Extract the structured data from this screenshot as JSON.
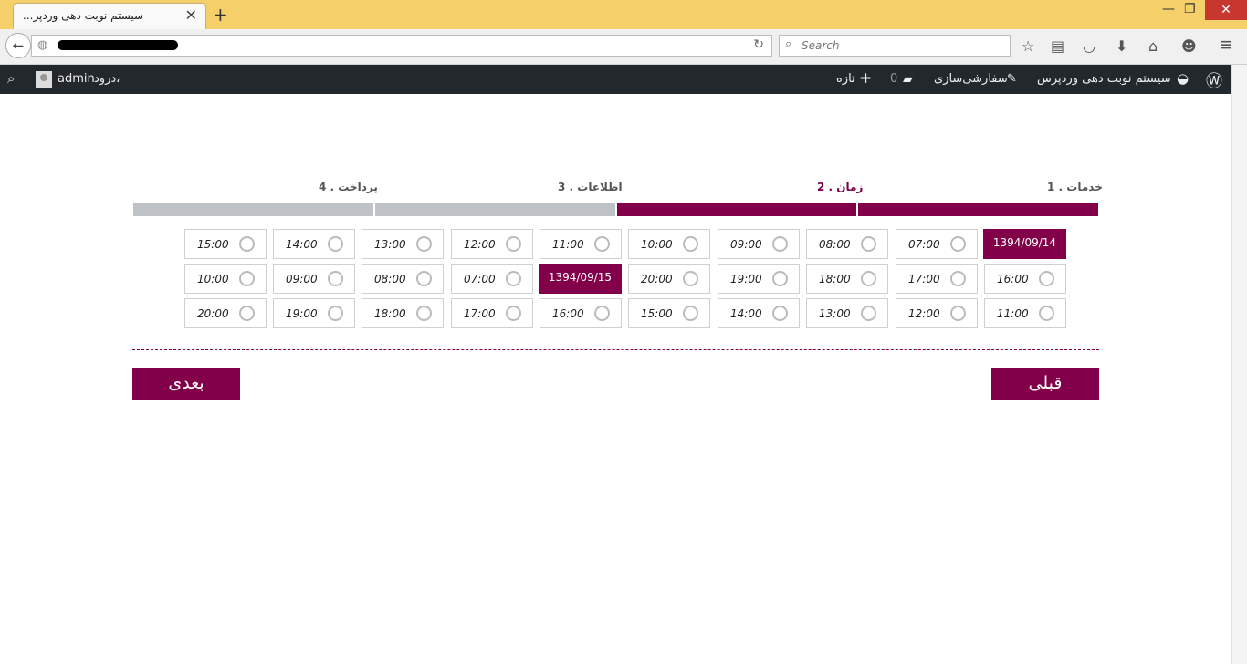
{
  "browser": {
    "tab_title": "سیستم نوبت دهی وردپر...",
    "search_placeholder": "Search",
    "new_tab": "+",
    "close_tab": "✕"
  },
  "adminbar": {
    "site_name": "سیستم نوبت دهی وردپرس",
    "customize": "سفارشی‌سازی",
    "comments_count": "0",
    "new_label": "تازه",
    "greeting": "درود،",
    "user": "admin"
  },
  "steps": [
    {
      "label": "1 . خدمات",
      "state": "done"
    },
    {
      "label": "2 . زمان",
      "state": "active"
    },
    {
      "label": "3 . اطلاعات",
      "state": "todo"
    },
    {
      "label": "4 . پرداخت",
      "state": "todo"
    }
  ],
  "schedule": {
    "days": [
      {
        "date": "1394/09/14",
        "times": [
          "07:00",
          "08:00",
          "09:00",
          "10:00",
          "11:00",
          "12:00",
          "13:00",
          "14:00",
          "15:00",
          "16:00",
          "17:00",
          "18:00",
          "19:00",
          "20:00"
        ]
      },
      {
        "date": "1394/09/15",
        "times": [
          "07:00",
          "08:00",
          "09:00",
          "10:00",
          "11:00",
          "12:00",
          "13:00",
          "14:00",
          "15:00",
          "16:00",
          "17:00",
          "18:00",
          "19:00",
          "20:00"
        ]
      }
    ]
  },
  "buttons": {
    "prev": "قبلی",
    "next": "بعدی"
  },
  "colors": {
    "accent": "#820049",
    "inactive": "#bfc3c7",
    "adminbar": "#23282d",
    "tabbar": "#f5d06a"
  }
}
